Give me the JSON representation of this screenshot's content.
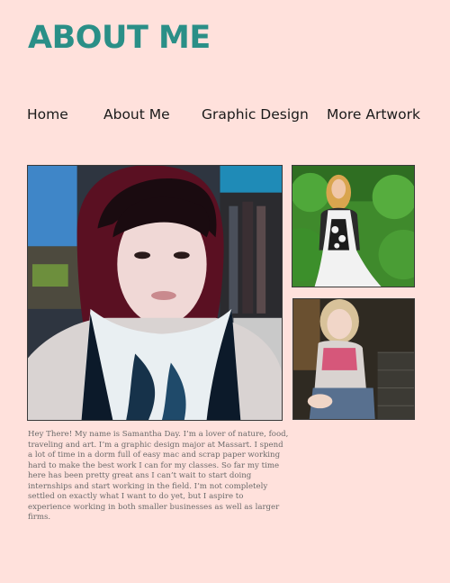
{
  "header": {
    "title": "ABOUT ME"
  },
  "nav": {
    "items": [
      {
        "label": "Home"
      },
      {
        "label": "About Me"
      },
      {
        "label": "Graphic Design"
      },
      {
        "label": "More Artwork"
      }
    ]
  },
  "gallery": {
    "main_photo": {
      "description": "selfie portrait"
    },
    "photo_two": {
      "description": "woman standing in garden"
    },
    "photo_three": {
      "description": "child sitting"
    }
  },
  "bio": {
    "text": "Hey There! My name is Samantha Day. I’m a lover of nature, food, traveling and art. I’m a graphic design major at Massart. I spend a lot of time in a dorm full of easy mac and scrap paper working hard to make the best work I can for my classes. So far my time here has been pretty great ans I can’t wait to start doing internships and start working in the field. I’m not completely settled on exactly what I want to do yet, but I aspire to experience working in both smaller businesses as well as larger firms."
  },
  "colors": {
    "background": "#ffe1dc",
    "title": "#2a8f87",
    "nav_text": "#1a1a1a",
    "body_text": "#6a6a6a"
  }
}
